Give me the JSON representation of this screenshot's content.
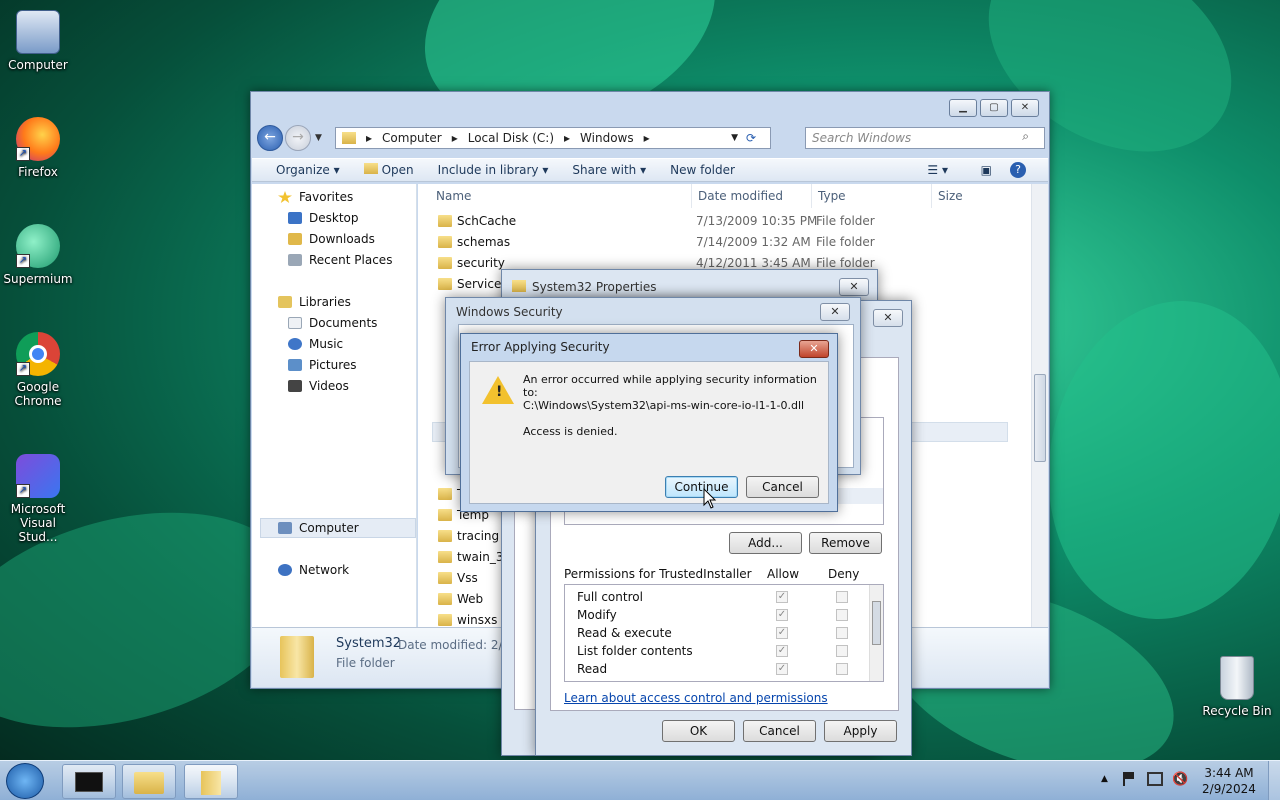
{
  "desktop": {
    "icons": [
      {
        "label": "Computer"
      },
      {
        "label": "Firefox"
      },
      {
        "label": "Supermium"
      },
      {
        "label": "Google Chrome"
      },
      {
        "label": "Microsoft Visual Stud..."
      },
      {
        "label": "Recycle Bin"
      }
    ]
  },
  "explorer": {
    "breadcrumb": [
      "Computer",
      "Local Disk (C:)",
      "Windows"
    ],
    "search_placeholder": "Search Windows",
    "toolbar": {
      "organize": "Organize",
      "open": "Open",
      "include": "Include in library",
      "share": "Share with",
      "new_folder": "New folder"
    },
    "nav": {
      "favorites": "Favorites",
      "desktop": "Desktop",
      "downloads": "Downloads",
      "recent": "Recent Places",
      "libraries": "Libraries",
      "documents": "Documents",
      "music": "Music",
      "pictures": "Pictures",
      "videos": "Videos",
      "computer": "Computer",
      "network": "Network"
    },
    "columns": {
      "name": "Name",
      "date": "Date modified",
      "type": "Type",
      "size": "Size"
    },
    "rows_top": [
      {
        "name": "SchCache",
        "date": "7/13/2009 10:35 PM",
        "type": "File folder"
      },
      {
        "name": "schemas",
        "date": "7/14/2009 1:32 AM",
        "type": "File folder"
      },
      {
        "name": "security",
        "date": "4/12/2011 3:45 AM",
        "type": "File folder"
      },
      {
        "name": "ServiceP",
        "date": "",
        "type": ""
      }
    ],
    "rows_bottom": [
      {
        "name": "T",
        "date": "",
        "type": ""
      },
      {
        "name": "Temp",
        "date": "",
        "type": ""
      },
      {
        "name": "tracing",
        "date": "",
        "type": ""
      },
      {
        "name": "twain_32",
        "date": "",
        "type": ""
      },
      {
        "name": "Vss",
        "date": "",
        "type": ""
      },
      {
        "name": "Web",
        "date": "",
        "type": ""
      },
      {
        "name": "winsxs",
        "date": "",
        "type": ""
      }
    ],
    "details": {
      "name": "System32",
      "date_label": "Date modified: 2/9/",
      "type": "File folder"
    }
  },
  "props_dialog": {
    "title": "System32 Properties"
  },
  "security_dialog": {
    "title": "Windows Security",
    "add": "Add...",
    "remove": "Remove",
    "perm_header": "Permissions for TrustedInstaller",
    "allow": "Allow",
    "deny": "Deny",
    "perms": [
      {
        "label": "Full control",
        "allow": true
      },
      {
        "label": "Modify",
        "allow": true
      },
      {
        "label": "Read & execute",
        "allow": true
      },
      {
        "label": "List folder contents",
        "allow": true
      },
      {
        "label": "Read",
        "allow": true
      }
    ],
    "learn_link": "Learn about access control and permissions",
    "ok": "OK",
    "cancel": "Cancel",
    "apply": "Apply"
  },
  "error_dialog": {
    "title": "Error Applying Security",
    "line1": "An error occurred while applying security information to:",
    "path": "C:\\Windows\\System32\\api-ms-win-core-io-l1-1-0.dll",
    "line3": "Access is denied.",
    "continue": "Continue",
    "cancel": "Cancel"
  },
  "taskbar": {
    "time": "3:44 AM",
    "date": "2/9/2024"
  }
}
